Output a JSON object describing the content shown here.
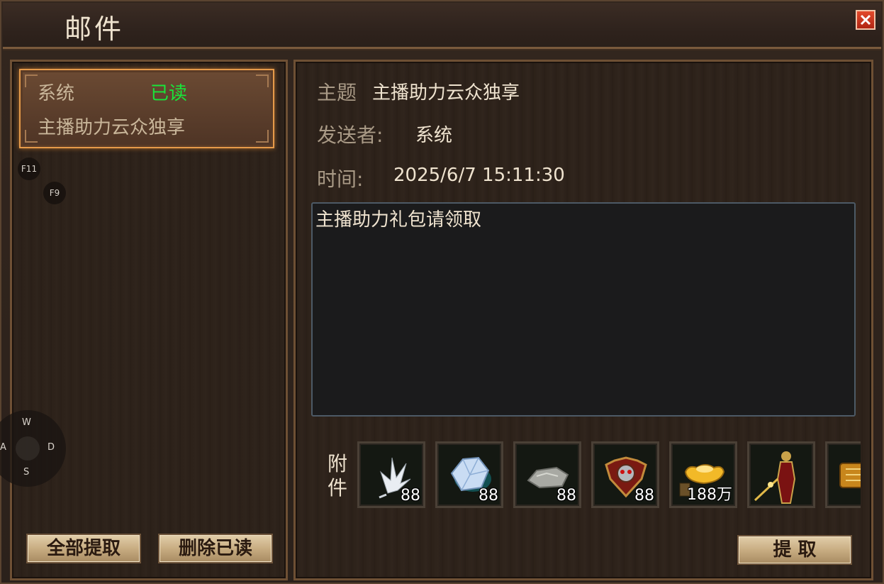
{
  "window": {
    "title": "邮件"
  },
  "mail_list": [
    {
      "sender": "系统",
      "status": "已读",
      "subject": "主播助力云众独享"
    }
  ],
  "hotkeys": {
    "f11": "F11",
    "f9": "F9"
  },
  "dpad": {
    "up": "W",
    "left": "A",
    "right": "D",
    "down": "S"
  },
  "left_buttons": {
    "claim_all": "全部提取",
    "delete_read": "删除已读"
  },
  "detail": {
    "subject_label": "主题",
    "subject": "主播助力云众独享",
    "sender_label": "发送者:",
    "sender": "系统",
    "time_label": "时间:",
    "time": "2025/6/7 15:11:30",
    "content": "主播助力礼包请领取",
    "attachments_label": "附件",
    "attachments": [
      {
        "icon": "white-feather-icon",
        "qty": "88"
      },
      {
        "icon": "blue-crystal-icon",
        "qty": "88"
      },
      {
        "icon": "stone-ore-icon",
        "qty": "88"
      },
      {
        "icon": "demon-emblem-icon",
        "qty": "88"
      },
      {
        "icon": "gold-ingot-icon",
        "qty": "188万"
      },
      {
        "icon": "warrior-figure-icon",
        "qty": ""
      },
      {
        "icon": "gold-scroll-icon",
        "qty": ""
      }
    ],
    "claim_button": "提 取"
  },
  "colors": {
    "read_status": "#19e53a",
    "selected_border": "#e59a4a",
    "close_button": "#d23a20"
  }
}
